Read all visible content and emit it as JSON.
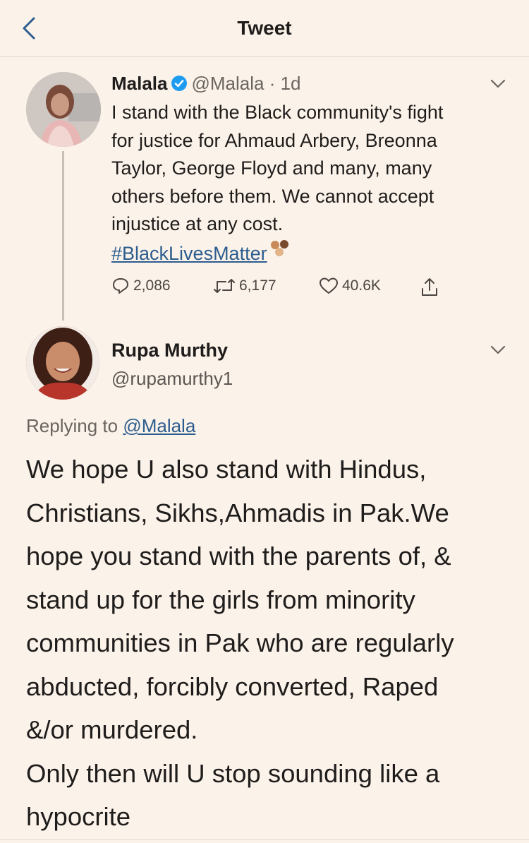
{
  "header": {
    "title": "Tweet"
  },
  "tweet1": {
    "author_name": "Malala",
    "handle_time": "@Malala · 1d",
    "text_lines": [
      "I stand with the Black community's fight",
      "for justice for Ahmaud Arbery, Breonna",
      "Taylor, George Floyd and many, many",
      "others before them. We cannot accept",
      "injustice at any cost."
    ],
    "hashtag": "#BlackLivesMatter",
    "replies": "2,086",
    "retweets": "6,177",
    "likes": "40.6K"
  },
  "tweet2": {
    "author_name": "Rupa Murthy",
    "handle": "@rupamurthy1",
    "replying_prefix": "Replying to",
    "replying_to": "@Malala",
    "text_lines": [
      "We hope U also stand with Hindus,",
      "Christians, Sikhs,Ahmadis in Pak.We",
      "hope you stand with the parents of, &",
      "stand up for the girls from minority",
      "communities in Pak who are regularly",
      "abducted, forcibly converted, Raped",
      "&/or murdered.",
      "Only then will U stop sounding like a",
      "hypocrite"
    ]
  },
  "colors": {
    "background": "#fbf2e9",
    "link": "#2c5d8f",
    "verified": "#1d9bf0"
  },
  "icons": [
    "back-chevron-icon",
    "verified-icon",
    "chevron-down-icon",
    "reply-icon",
    "retweet-icon",
    "like-icon",
    "share-icon"
  ]
}
